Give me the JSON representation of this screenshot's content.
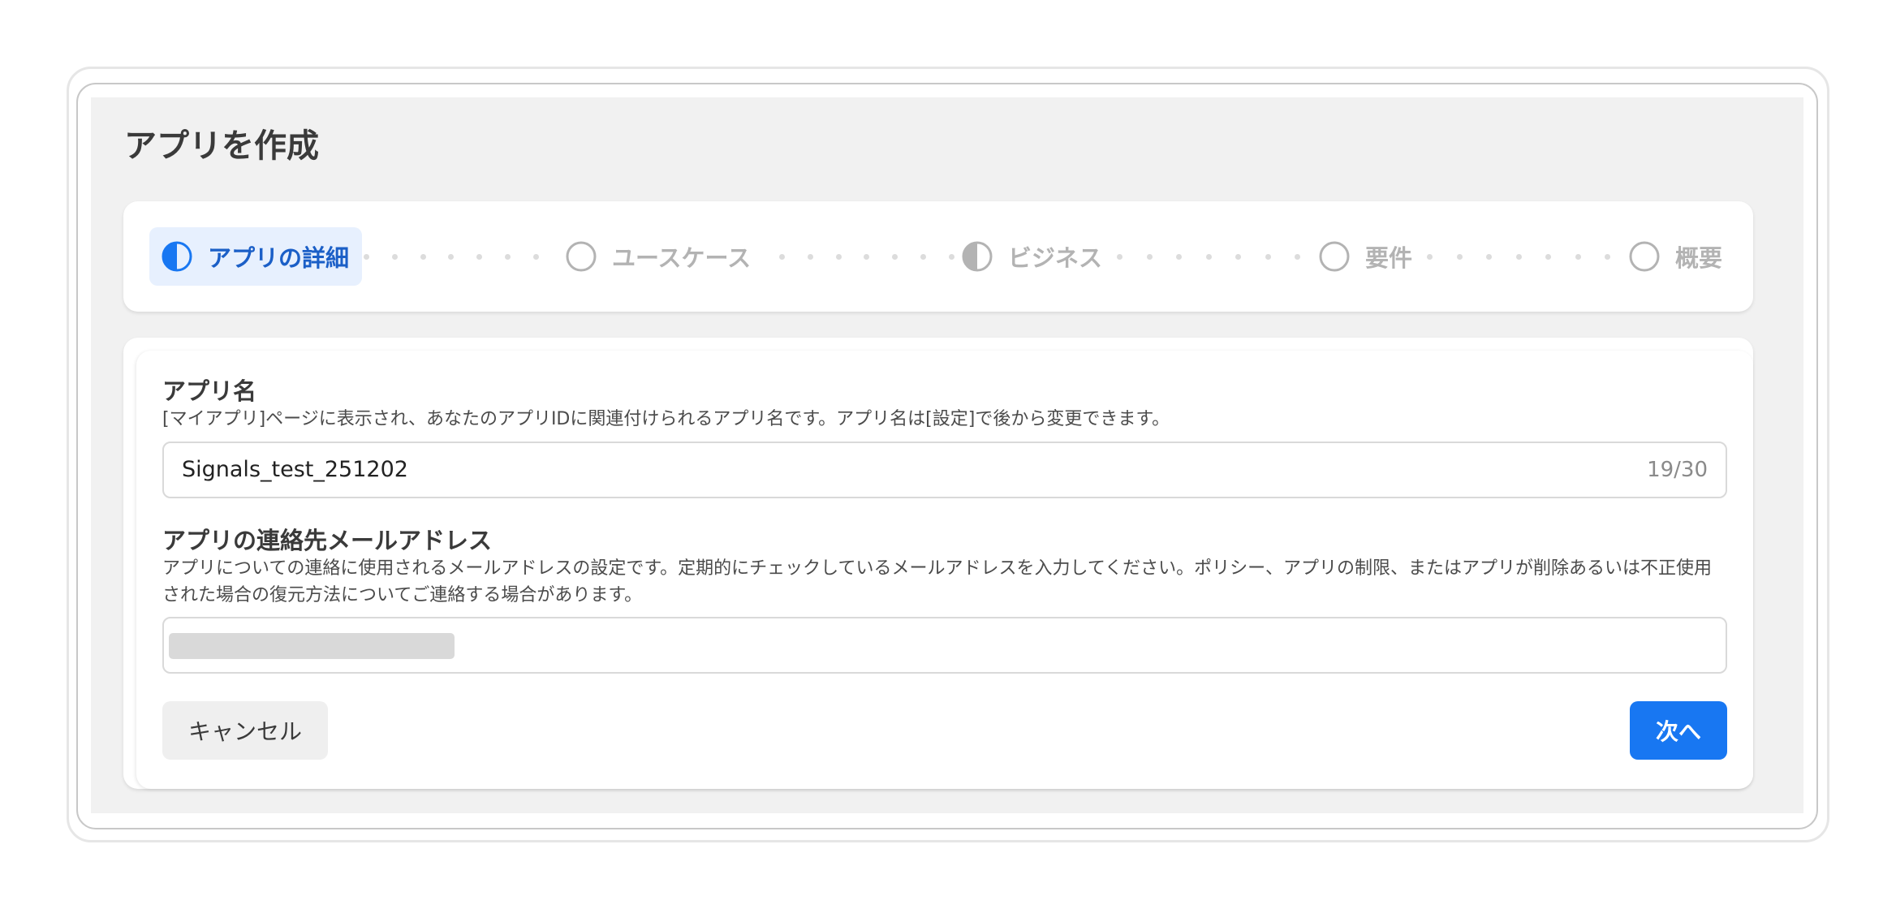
{
  "dialog": {
    "title": "アプリを作成"
  },
  "stepper": {
    "steps": [
      {
        "label": "アプリの詳細",
        "state": "active"
      },
      {
        "label": "ユースケース",
        "state": "pending"
      },
      {
        "label": "ビジネス",
        "state": "partial"
      },
      {
        "label": "要件",
        "state": "pending"
      },
      {
        "label": "概要",
        "state": "pending"
      }
    ]
  },
  "form": {
    "app_name": {
      "label": "アプリ名",
      "description": "[マイアプリ]ページに表示され、あなたのアプリIDに関連付けられるアプリ名です。アプリ名は[設定]で後から変更できます。",
      "value": "Signals_test_251202",
      "char_count": "19/30"
    },
    "contact_email": {
      "label": "アプリの連絡先メールアドレス",
      "description": "アプリについての連絡に使用されるメールアドレスの設定です。定期的にチェックしているメールアドレスを入力してください。ポリシー、アプリの制限、またはアプリが削除あるいは不正使用された場合の復元方法についてご連絡する場合があります。"
    }
  },
  "actions": {
    "cancel_label": "キャンセル",
    "next_label": "次へ"
  },
  "colors": {
    "accent": "#1877f2",
    "active_step_text": "#1b5fc7",
    "active_step_bg": "#e7f0fe",
    "inactive_step": "#b3b3b3",
    "panel_bg": "#f1f1f1"
  }
}
